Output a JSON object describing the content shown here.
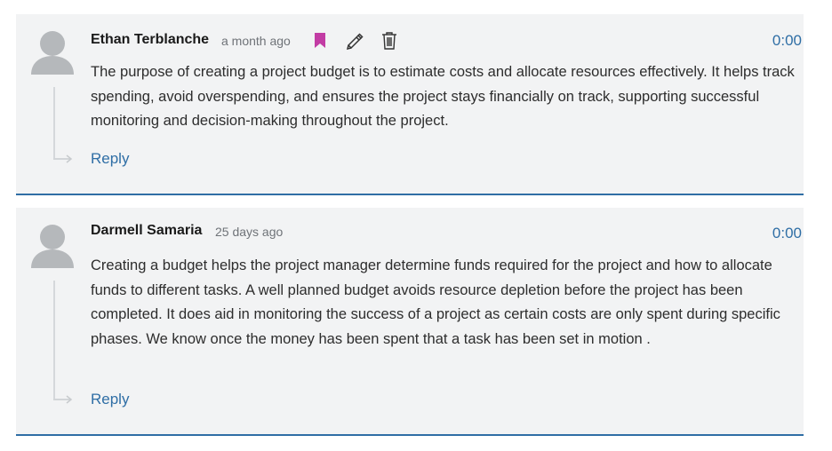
{
  "comments": [
    {
      "author": "Ethan Terblanche",
      "time": "a month ago",
      "timestamp": "0:00",
      "body": "The purpose of creating a project budget is to estimate costs and allocate resources effectively. It helps track spending, avoid overspending, and ensures the project stays financially on track, supporting successful monitoring and decision-making throughout the project.",
      "reply_label": "Reply",
      "icons": [
        "bookmark-icon",
        "pencil-icon",
        "trash-icon"
      ],
      "bookmark_color": "#c23ca4"
    },
    {
      "author": "Darmell Samaria",
      "time": "25 days ago",
      "timestamp": "0:00",
      "body": "Creating a budget helps the project manager determine funds required for the project and how to allocate funds to different tasks. A well planned budget avoids resource depletion before the project has been completed. It does aid in monitoring the success of a project as certain costs are only spent during specific phases. We know once the money has been spent that a task has been set in motion .",
      "reply_label": "Reply"
    }
  ],
  "colors": {
    "accent": "#2f6ea5",
    "card_bg": "#f2f3f4",
    "avatar": "#b5b8bb"
  }
}
